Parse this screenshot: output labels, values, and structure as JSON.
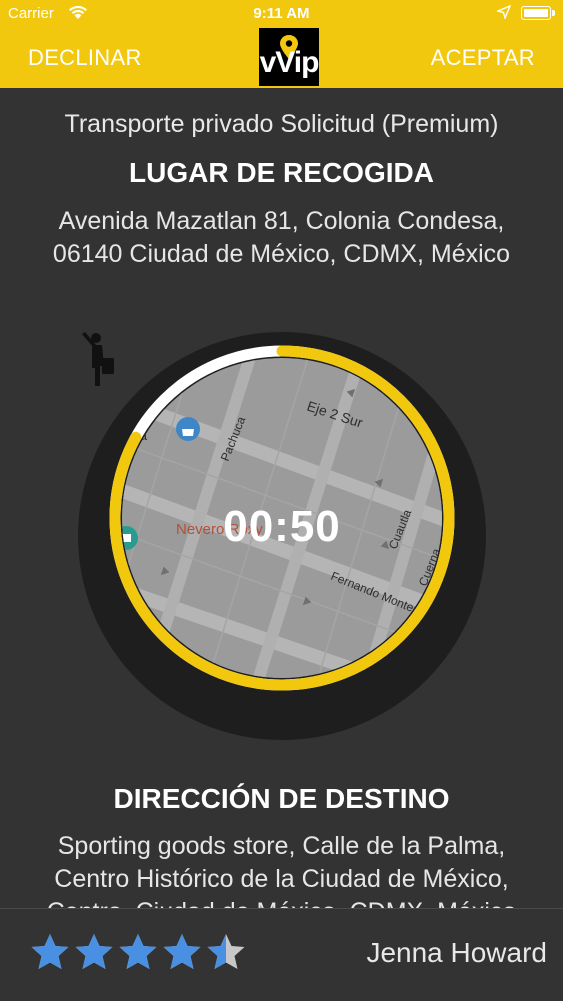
{
  "status_bar": {
    "carrier": "Carrier",
    "time": "9:11 AM"
  },
  "nav": {
    "decline_label": "DECLINAR",
    "accept_label": "ACEPTAR",
    "logo_text": "vVip"
  },
  "request": {
    "subtitle": "Transporte privado Solicitud (Premium)",
    "pickup_heading": "LUGAR DE RECOGIDA",
    "pickup_address_lines": [
      "Avenida Mazatlan 81,  Colonia Condesa,",
      "06140 Ciudad de México,  CDMX,  México"
    ],
    "destination_heading": "DIRECCIÓN DE DESTINO",
    "destination_address_lines": [
      "Sporting goods store, Calle de la Palma,",
      "Centro Histórico de la Ciudad de México,",
      "Centro, Ciudad de México, CDMX, México"
    ]
  },
  "timer": {
    "countdown": "00:50",
    "progress_fraction": 0.83,
    "map_labels": {
      "street_1": "Eje 2 Sur",
      "street_2": "Pachuca",
      "street_3": "Cuautla",
      "street_4": "Fernando Montes",
      "street_5": "Cuerna",
      "place_1": "Nevero Roxy",
      "place_2": "uca"
    },
    "colors": {
      "ring": "#f2c80f",
      "ring_remaining": "#ffffff",
      "map_bg": "#9b9b9b"
    }
  },
  "driver": {
    "rating": 4.5,
    "name": "Jenna Howard"
  },
  "colors": {
    "brand_yellow": "#f2c80f",
    "background": "#333333",
    "star": "#4a90e2"
  }
}
